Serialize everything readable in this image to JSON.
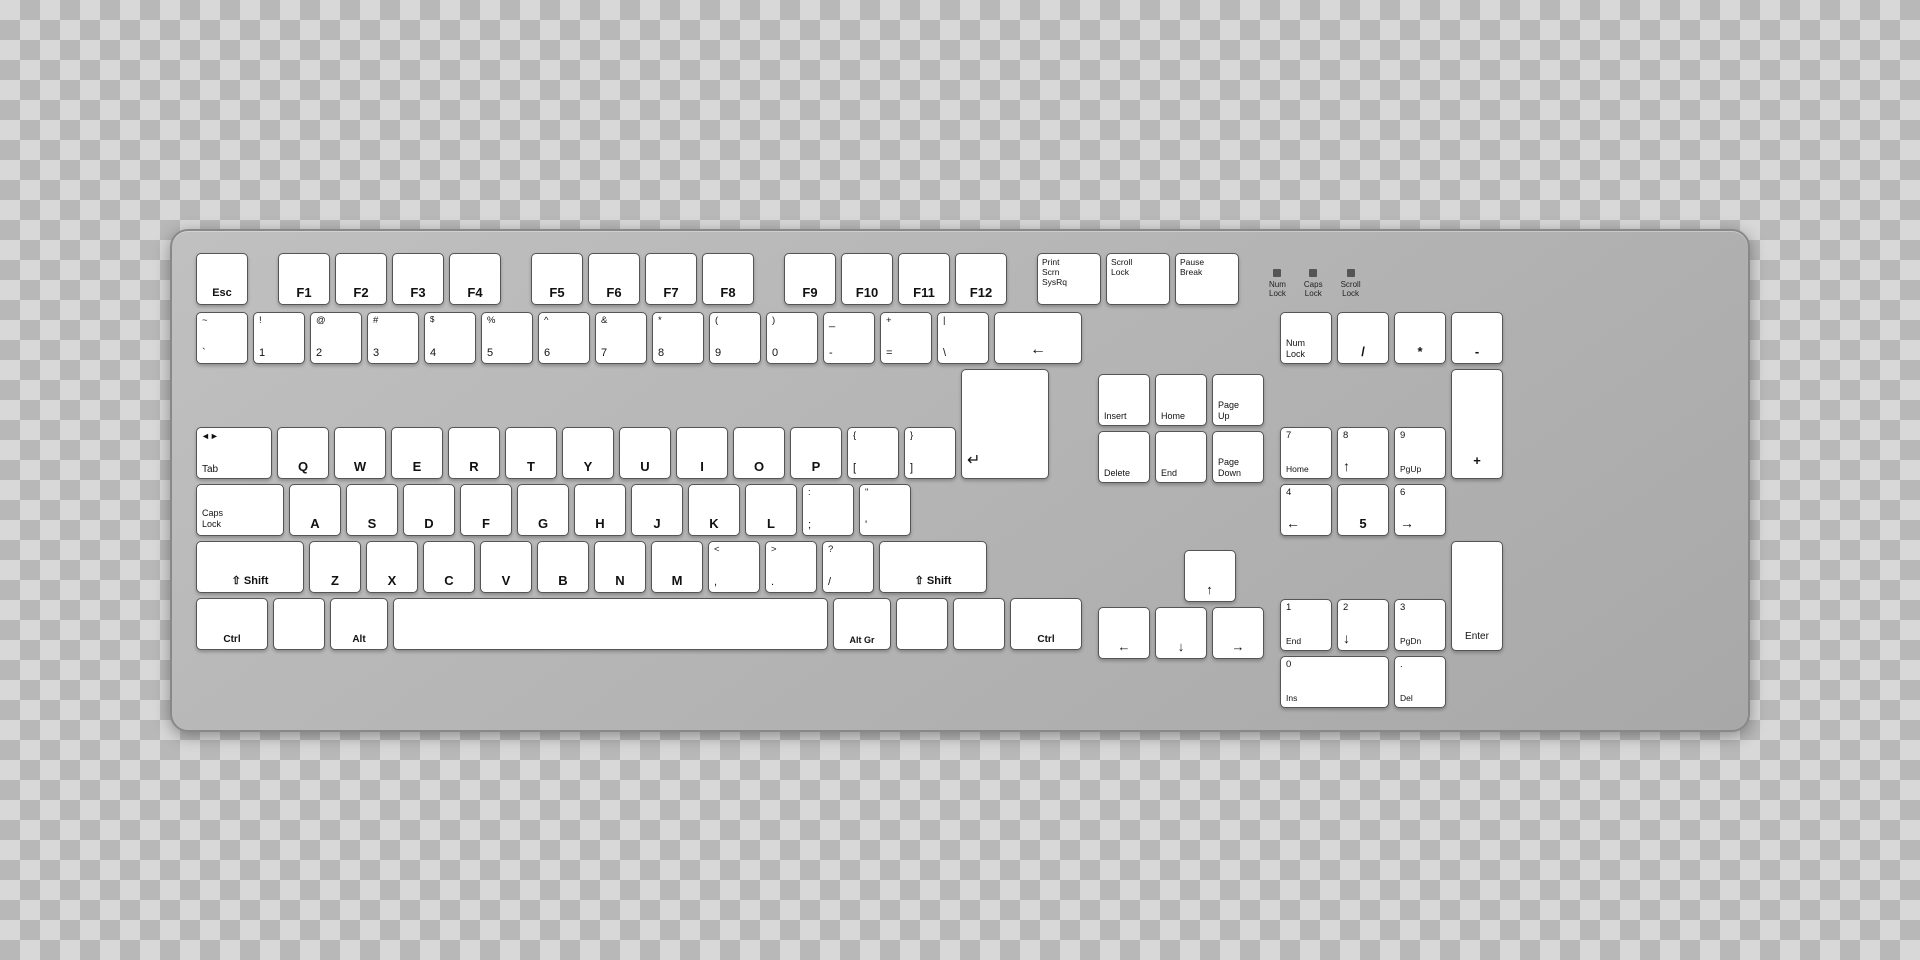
{
  "keyboard": {
    "background_color": "#b0b0b0",
    "rows": {
      "function_row": [
        "Esc",
        "",
        "F1",
        "F2",
        "F3",
        "F4",
        "",
        "F5",
        "F6",
        "F7",
        "F8",
        "",
        "F9",
        "F10",
        "F11",
        "F12"
      ],
      "number_row": [
        "`",
        "1",
        "2",
        "3",
        "4",
        "5",
        "6",
        "7",
        "8",
        "9",
        "0",
        "-",
        "=",
        "\\",
        "←"
      ],
      "qwerty_row": [
        "Tab",
        "Q",
        "W",
        "E",
        "R",
        "T",
        "Y",
        "U",
        "I",
        "O",
        "P",
        "[",
        "]"
      ],
      "home_row": [
        "Caps Lock",
        "A",
        "S",
        "D",
        "F",
        "G",
        "H",
        "J",
        "K",
        "L",
        ";",
        "'"
      ],
      "shift_row": [
        "Shift",
        "Z",
        "X",
        "C",
        "V",
        "B",
        "N",
        "M",
        ",",
        ".",
        "/",
        "Shift"
      ],
      "bottom_row": [
        "Ctrl",
        "",
        "Alt",
        "",
        "Alt Gr",
        "",
        "",
        "Ctrl"
      ]
    }
  }
}
